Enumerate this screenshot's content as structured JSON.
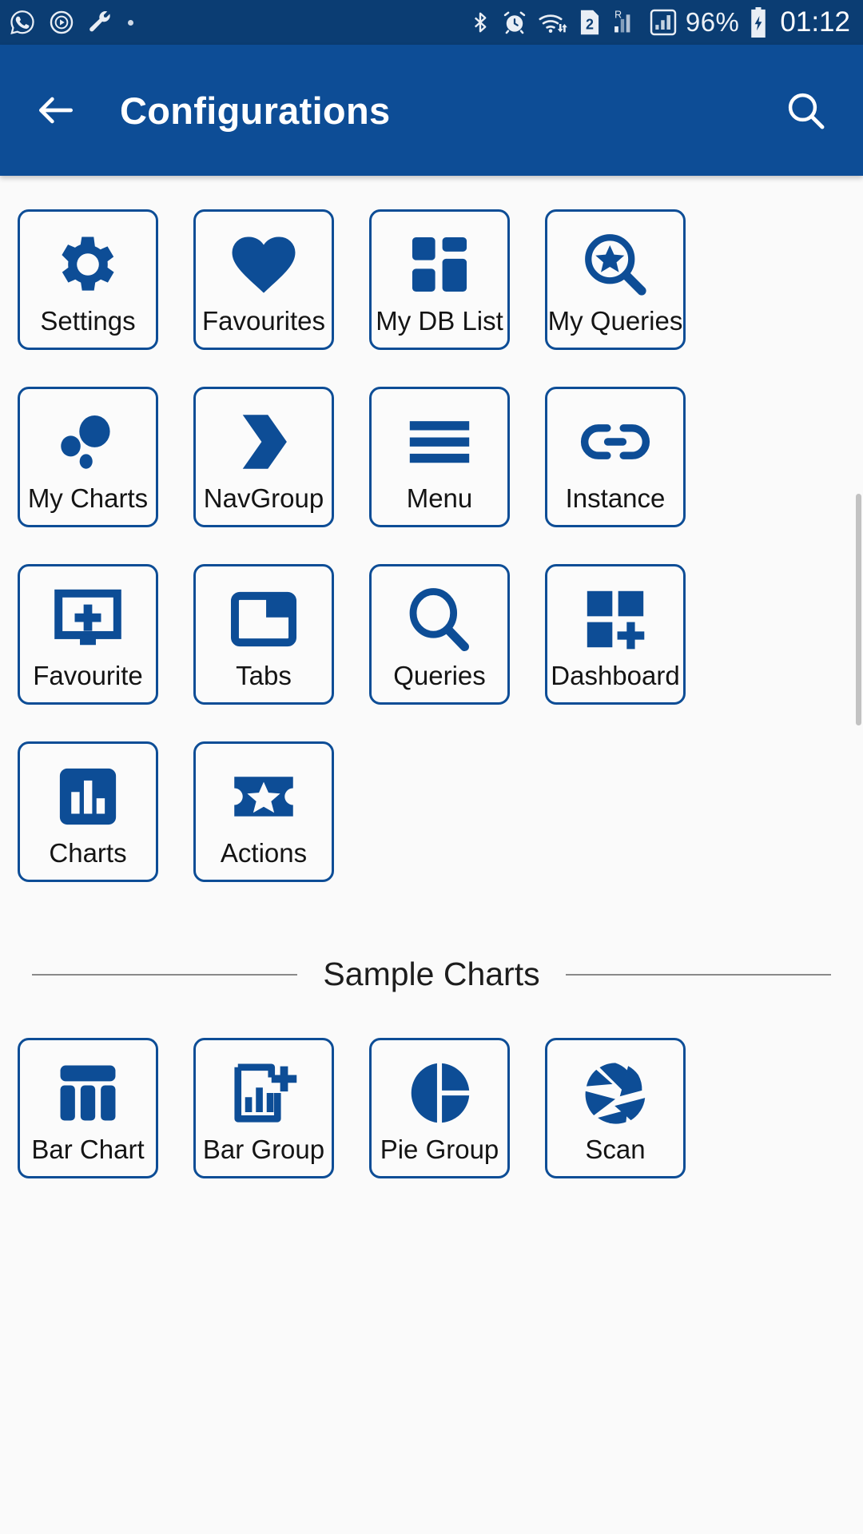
{
  "statusbar": {
    "left_icons": [
      "whatsapp-icon",
      "play-circle-icon",
      "wrench-icon",
      "dot-icon"
    ],
    "right_icons": [
      "bluetooth-icon",
      "alarm-icon",
      "wifi-icon",
      "sim2-icon",
      "roaming-signal-icon",
      "signal-icon"
    ],
    "battery_percent": "96%",
    "battery_icon": "battery-charging-icon",
    "clock": "01:12"
  },
  "appbar": {
    "back_icon": "back-arrow-icon",
    "title": "Configurations",
    "search_icon": "search-icon"
  },
  "main": {
    "tiles": [
      {
        "label": "Settings",
        "icon": "gear-icon"
      },
      {
        "label": "Favourites",
        "icon": "heart-icon"
      },
      {
        "label": "My DB List",
        "icon": "dashboard-tiles-icon"
      },
      {
        "label": "My Queries",
        "icon": "magnifier-star-icon"
      },
      {
        "label": "My Charts",
        "icon": "bubble-chart-icon"
      },
      {
        "label": "NavGroup",
        "icon": "chevron-right-icon"
      },
      {
        "label": "Menu",
        "icon": "hamburger-icon"
      },
      {
        "label": "Instance",
        "icon": "link-icon"
      },
      {
        "label": "Favourite",
        "icon": "monitor-plus-icon"
      },
      {
        "label": "Tabs",
        "icon": "tab-folder-icon"
      },
      {
        "label": "Queries",
        "icon": "magnifier-icon"
      },
      {
        "label": "Dashboard",
        "icon": "grid-plus-icon"
      },
      {
        "label": "Charts",
        "icon": "bar-chart-filled-icon"
      },
      {
        "label": "Actions",
        "icon": "ticket-star-icon"
      }
    ],
    "section_title": "Sample Charts",
    "chart_tiles": [
      {
        "label": "Bar Chart",
        "icon": "bar-chart-columns-icon"
      },
      {
        "label": "Bar Group",
        "icon": "bar-chart-plus-icon"
      },
      {
        "label": "Pie Group",
        "icon": "pie-chart-icon"
      },
      {
        "label": "Scan",
        "icon": "aperture-icon"
      }
    ]
  },
  "colors": {
    "status_bar": "#0b3d73",
    "app_bar": "#0d4d96",
    "accent": "#0d4d96",
    "page_bg": "#fafafa",
    "label_text": "#141414"
  }
}
